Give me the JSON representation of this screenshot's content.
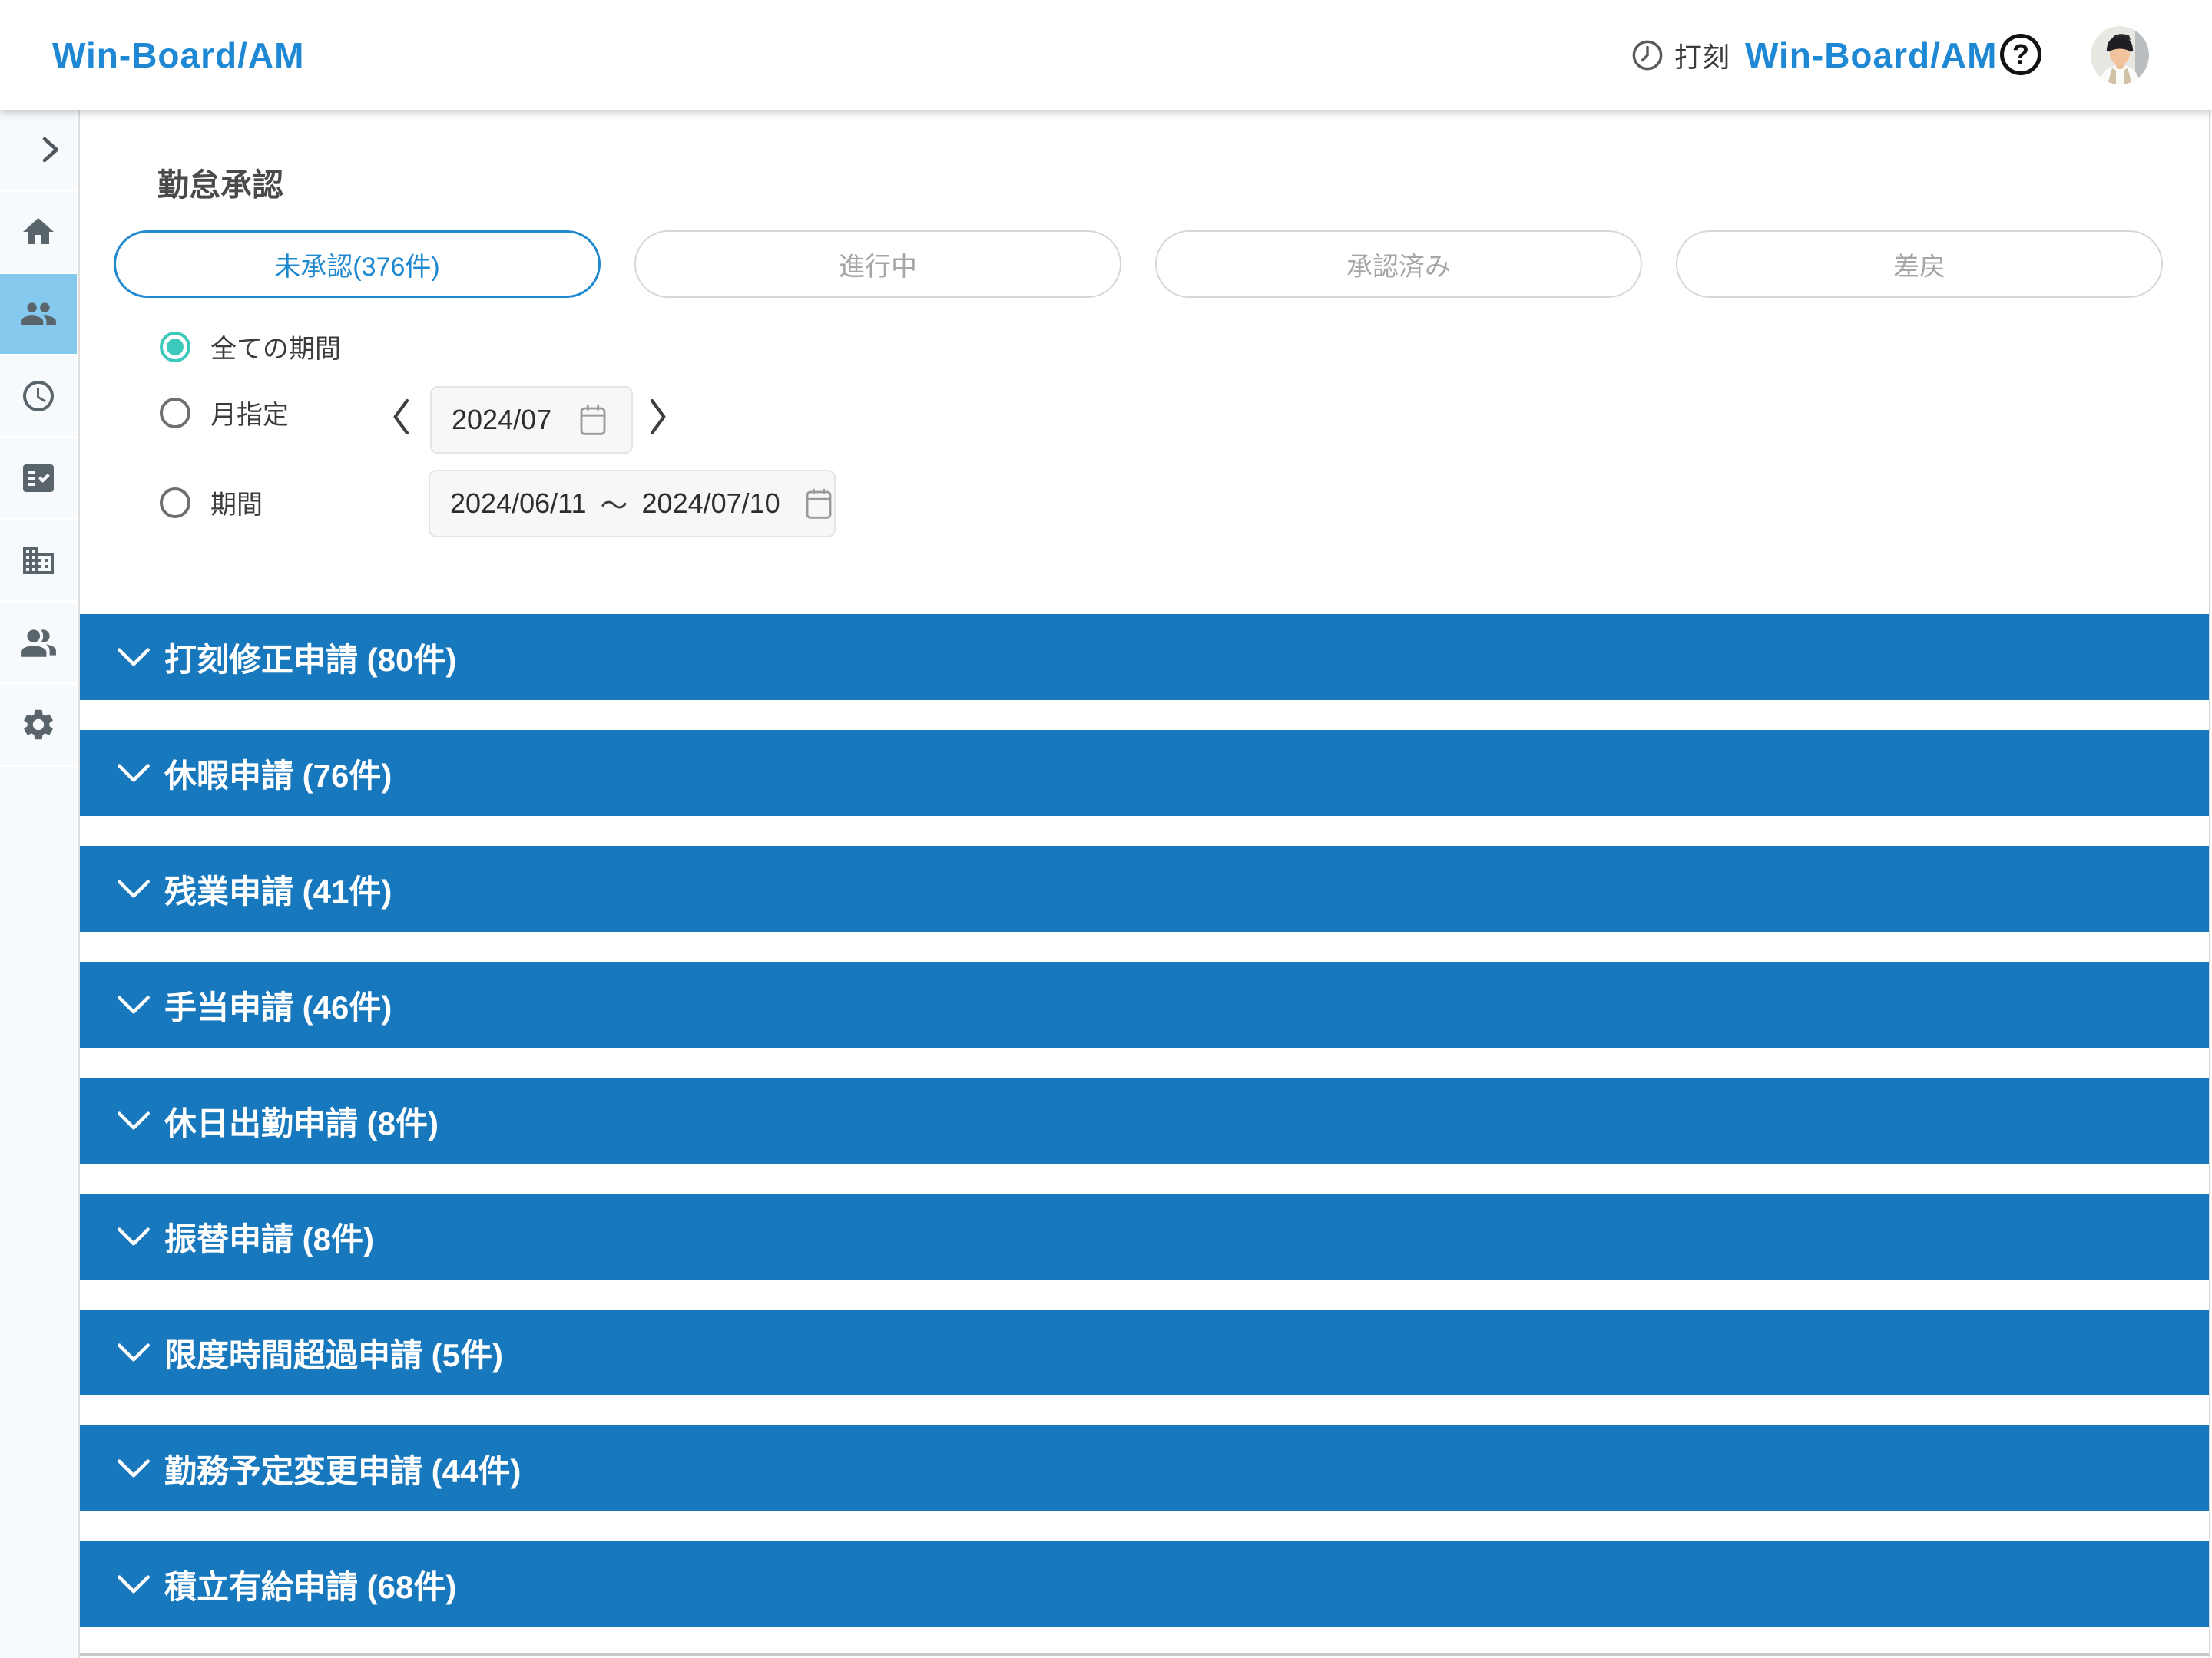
{
  "header": {
    "logo_text": "Win-Board/AM",
    "punch_label": "打刻",
    "product_title": "Win-Board/AM",
    "help_label": "?"
  },
  "sidebar": {
    "selected_index": 2,
    "items": [
      {
        "icon": "chevron-right"
      },
      {
        "icon": "home"
      },
      {
        "icon": "people"
      },
      {
        "icon": "clock"
      },
      {
        "icon": "checklist"
      },
      {
        "icon": "building"
      },
      {
        "icon": "people-alt"
      },
      {
        "icon": "gear"
      }
    ]
  },
  "main": {
    "title": "勤怠承認",
    "tabs": [
      {
        "label": "未承認(376件)",
        "active": true
      },
      {
        "label": "進行中",
        "active": false
      },
      {
        "label": "承認済み",
        "active": false
      },
      {
        "label": "差戻",
        "active": false
      }
    ],
    "filters": {
      "options": [
        {
          "label": "全ての期間",
          "selected": true
        },
        {
          "label": "月指定",
          "selected": false
        },
        {
          "label": "期間",
          "selected": false
        }
      ],
      "month_value": "2024/07",
      "range_start": "2024/06/11",
      "range_separator": "～",
      "range_end": "2024/07/10"
    },
    "sections": [
      {
        "label": "打刻修正申請 (80件)"
      },
      {
        "label": "休暇申請 (76件)"
      },
      {
        "label": "残業申請 (41件)"
      },
      {
        "label": "手当申請 (46件)"
      },
      {
        "label": "休日出勤申請 (8件)"
      },
      {
        "label": "振替申請 (8件)"
      },
      {
        "label": "限度時間超過申請 (5件)"
      },
      {
        "label": "勤務予定変更申請 (44件)"
      },
      {
        "label": "積立有給申請 (68件)"
      }
    ]
  },
  "colors": {
    "brand_blue": "#1e88d4",
    "bar_blue": "#1878be",
    "radio_teal": "#3cc8ba",
    "sidebar_selected_bg": "#86c9ee"
  }
}
